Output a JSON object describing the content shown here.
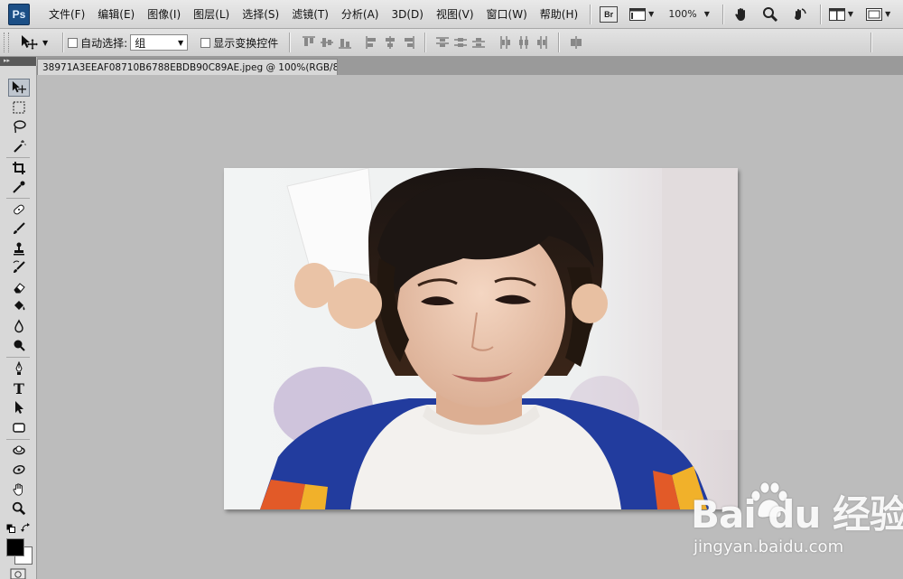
{
  "app": {
    "logo_text": "Ps",
    "menus": [
      "文件(F)",
      "编辑(E)",
      "图像(I)",
      "图层(L)",
      "选择(S)",
      "滤镜(T)",
      "分析(A)",
      "3D(D)",
      "视图(V)",
      "窗口(W)",
      "帮助(H)"
    ],
    "bridge_label": "Br",
    "zoom_level": "100%"
  },
  "options": {
    "auto_select_label": "自动选择:",
    "auto_select_value": "组",
    "show_transform_label": "显示变换控件"
  },
  "document": {
    "tab_title": "38971A3EEAF08710B6788EBDB90C89AE.jpeg @ 100%(RGB/8#)",
    "close_glyph": "×"
  },
  "tools": [
    {
      "name": "move-tool",
      "icon": "move-icon"
    },
    {
      "name": "marquee-tool",
      "icon": "marquee-icon"
    },
    {
      "name": "lasso-tool",
      "icon": "lasso-icon"
    },
    {
      "name": "magic-wand-tool",
      "icon": "magic-wand-icon"
    },
    {
      "name": "crop-tool",
      "icon": "crop-icon"
    },
    {
      "name": "eyedropper-tool",
      "icon": "eyedropper-icon"
    },
    {
      "name": "healing-brush-tool",
      "icon": "bandage-icon"
    },
    {
      "name": "brush-tool",
      "icon": "brush-icon"
    },
    {
      "name": "clone-stamp-tool",
      "icon": "stamp-icon"
    },
    {
      "name": "history-brush-tool",
      "icon": "history-brush-icon"
    },
    {
      "name": "eraser-tool",
      "icon": "eraser-icon"
    },
    {
      "name": "paint-bucket-tool",
      "icon": "bucket-icon"
    },
    {
      "name": "blur-tool",
      "icon": "drop-icon"
    },
    {
      "name": "dodge-tool",
      "icon": "dodge-icon"
    },
    {
      "name": "pen-tool",
      "icon": "pen-icon"
    },
    {
      "name": "type-tool",
      "icon": "type-icon",
      "glyph": "T"
    },
    {
      "name": "path-selection-tool",
      "icon": "arrow-icon"
    },
    {
      "name": "shape-tool",
      "icon": "rectangle-icon"
    },
    {
      "name": "3d-rotate-tool",
      "icon": "3d-rotate-icon"
    },
    {
      "name": "3d-orbit-tool",
      "icon": "3d-orbit-icon"
    },
    {
      "name": "hand-tool",
      "icon": "hand-icon"
    },
    {
      "name": "zoom-tool",
      "icon": "zoom-icon"
    }
  ],
  "colors": {
    "foreground": "#000000",
    "background": "#ffffff",
    "workspace": "#bcbcbc"
  },
  "watermark": {
    "brand": "Bai du 经验",
    "url": "jingyan.baidu.com"
  }
}
